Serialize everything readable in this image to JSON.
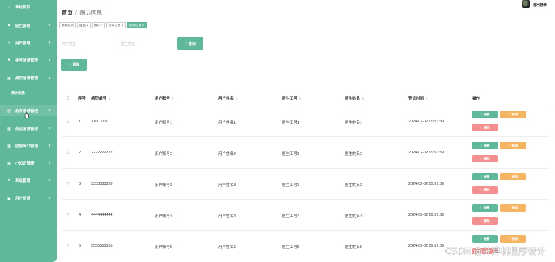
{
  "sidebar": {
    "items": [
      {
        "icon": "home-icon",
        "glyph": "⌂",
        "label": "系统首页",
        "chevron": ""
      },
      {
        "icon": "pin-icon",
        "glyph": "●",
        "label": "医生管理",
        "chevron": "∨"
      },
      {
        "icon": "list-icon",
        "glyph": "☰",
        "label": "用户管理",
        "chevron": "∨"
      },
      {
        "icon": "lock-icon",
        "glyph": "■",
        "label": "挂号信息管理",
        "chevron": "∨"
      },
      {
        "icon": "grid-icon",
        "glyph": "▦",
        "label": "病历信息管理",
        "chevron": "∧"
      },
      {
        "icon": "doc-icon",
        "glyph": "▤",
        "label": "药方信息管理",
        "chevron": "∨"
      },
      {
        "icon": "grid-icon",
        "glyph": "▦",
        "label": "药品信息管理",
        "chevron": "∨"
      },
      {
        "icon": "grid-icon",
        "glyph": "▦",
        "label": "医院简介管理",
        "chevron": "∨"
      },
      {
        "icon": "grid-icon",
        "glyph": "▦",
        "label": "小知识管理",
        "chevron": "∨"
      },
      {
        "icon": "user-icon",
        "glyph": "●",
        "label": "系统管理",
        "chevron": "∨"
      },
      {
        "icon": "person-card-icon",
        "glyph": "▣",
        "label": "用户信息",
        "chevron": "∨"
      }
    ],
    "sub_item": "病历信息"
  },
  "header": {
    "home": "首页",
    "separator": "/",
    "current": "病历信息",
    "logout": "退出登录"
  },
  "tabs": [
    "系统首页",
    "医生 ×",
    "用户 ×",
    "挂号信息 ×",
    "病历信息 ×"
  ],
  "search": {
    "username_placeholder": "用户姓名",
    "doctor_placeholder": "医生姓名",
    "query_button": "♡ 查询",
    "delete_button": "♡ 删除"
  },
  "table": {
    "columns": [
      "序号",
      "病历编号",
      "用户账号",
      "用户姓名",
      "医生工号",
      "医生姓名",
      "登记时间",
      "操作"
    ],
    "sort_glyph": "⇕",
    "action_view": "♡ 查看",
    "action_edit": "♡ 修改",
    "action_delete": "♡ 删除",
    "rows": [
      {
        "no": "1",
        "record_no": "1111111111",
        "user_account": "用户账号1",
        "user_name": "用户姓名1",
        "doctor_id": "医生工号1",
        "doctor_name": "医生姓名1",
        "time": "2024-02-02 09:51:39"
      },
      {
        "no": "2",
        "record_no": "2222222222",
        "user_account": "用户账号2",
        "user_name": "用户姓名2",
        "doctor_id": "医生工号2",
        "doctor_name": "医生姓名2",
        "time": "2024-02-02 09:51:39"
      },
      {
        "no": "3",
        "record_no": "3333333333",
        "user_account": "用户账号3",
        "user_name": "用户姓名3",
        "doctor_id": "医生工号3",
        "doctor_name": "医生姓名3",
        "time": "2024-02-02 09:51:39"
      },
      {
        "no": "4",
        "record_no": "4444444444",
        "user_account": "用户账号4",
        "user_name": "用户姓名4",
        "doctor_id": "医生工号4",
        "doctor_name": "医生姓名4",
        "time": "2024-02-02 09:51:39"
      },
      {
        "no": "5",
        "record_no": "5555555555",
        "user_account": "用户账号5",
        "user_name": "用户姓名5",
        "doctor_id": "医生工号5",
        "doctor_name": "医生姓名5",
        "time": "2024-02-02 09:51:39"
      }
    ]
  },
  "watermark": "CSDN @计算机程序设计",
  "colors": {
    "accent": "#5fb89a",
    "edit": "#f5b462",
    "delete": "#f59090"
  }
}
